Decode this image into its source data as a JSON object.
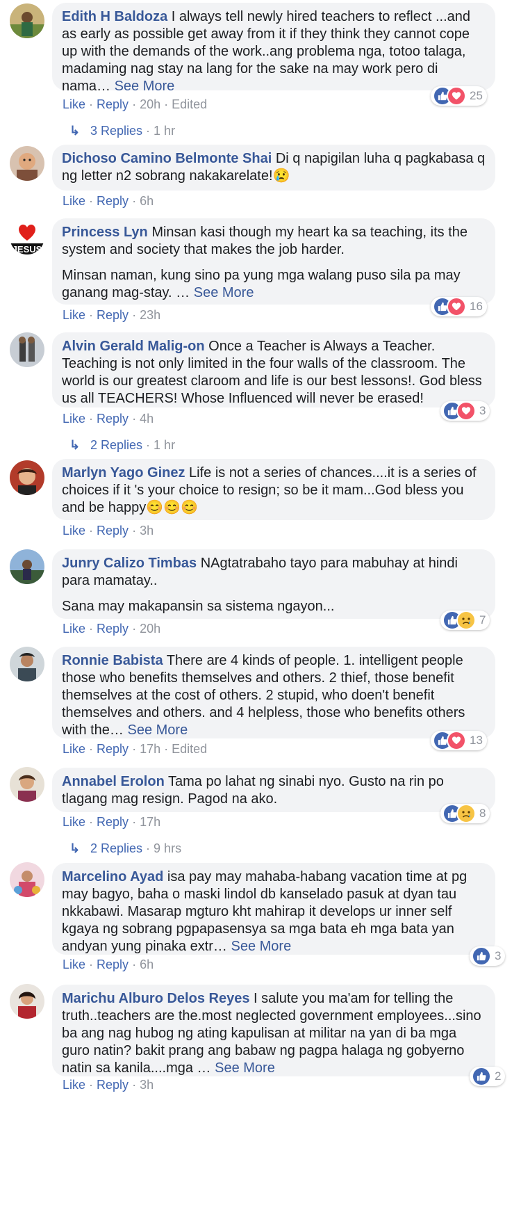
{
  "see_more": "See More",
  "like_label": "Like",
  "reply_label": "Reply",
  "comments": [
    {
      "author": "Edith H Baldoza",
      "paragraphs": [
        "I always tell newly hired teachers to reflect ...and as early as possible get away from it if they think they cannot cope up with the demands of the work..ang problema nga, totoo talaga, madaming nag stay na lang for the sake na may work pero di nama…"
      ],
      "see_more": true,
      "time": "20h",
      "edited": "Edited",
      "reactions": [
        "like",
        "love"
      ],
      "count": "25",
      "avatar_icon": "avatar-photo"
    },
    {
      "author": "Dichoso Camino Belmonte Shai",
      "paragraphs": [
        "Di q napigilan luha q pagkabasa q ng letter n2 sobrang nakakarelate!😢"
      ],
      "see_more": false,
      "time": "6h",
      "avatar_icon": "avatar-photo"
    },
    {
      "author": "Princess Lyn",
      "paragraphs": [
        "Minsan kasi though my heart ka sa teaching, its the system and society that makes the job harder.",
        "Minsan naman, kung sino pa yung mga walang puso sila pa may ganang mag-stay. …"
      ],
      "see_more": true,
      "time": "23h",
      "reactions": [
        "like",
        "love"
      ],
      "count": "16",
      "avatar_icon": "avatar-heart-jesus"
    },
    {
      "author": "Alvin Gerald Malig-on",
      "paragraphs": [
        "Once a Teacher is Always a Teacher. Teaching is not only limited in the four walls of the classroom. The world is our greatest claroom and life is our best lessons!. God bless us all TEACHERS! Whose Influenced will never be erased!"
      ],
      "see_more": false,
      "time": "4h",
      "reactions": [
        "like",
        "love"
      ],
      "count": "3",
      "avatar_icon": "avatar-photo"
    },
    {
      "author": "Marlyn Yago Ginez",
      "paragraphs": [
        "Life is not a series of chances....it is a series of choices if it 's your choice to resign; so be it mam...God bless you and be happy😊😊😊"
      ],
      "see_more": false,
      "time": "3h",
      "avatar_icon": "avatar-photo"
    },
    {
      "author": "Junry Calizo Timbas",
      "paragraphs": [
        "NAgtatrabaho tayo para mabuhay at hindi para mamatay..",
        "Sana may makapansin sa sistema ngayon..."
      ],
      "see_more": false,
      "time": "20h",
      "reactions": [
        "like",
        "sad"
      ],
      "count": "7",
      "avatar_icon": "avatar-photo"
    },
    {
      "author": "Ronnie Babista",
      "paragraphs": [
        "There are 4 kinds of people. 1. intelligent people those who benefits themselves and others. 2 thief, those benefit themselves at the cost of others. 2 stupid, who doen't benefit themselves and others. and 4 helpless, those who benefits others with the…"
      ],
      "see_more": true,
      "time": "17h",
      "edited": "Edited",
      "reactions": [
        "like",
        "love"
      ],
      "count": "13",
      "avatar_icon": "avatar-photo"
    },
    {
      "author": "Annabel Erolon",
      "paragraphs": [
        "Tama po lahat ng sinabi nyo. Gusto na rin po tlagang mag resign. Pagod na ako."
      ],
      "see_more": false,
      "time": "17h",
      "reactions": [
        "like",
        "sad"
      ],
      "count": "8",
      "avatar_icon": "avatar-photo"
    },
    {
      "author": "Marcelino Ayad",
      "paragraphs": [
        "isa pay may mahaba-habang vacation time at pg may bagyo, baha o maski lindol db kanselado pasuk at dyan tau nkkabawi. Masarap mgturo kht mahirap it develops ur inner self kgaya ng sobrang pgpapasensya sa mga bata eh mga bata yan andyan yung pinaka extr…"
      ],
      "see_more": true,
      "time": "6h",
      "reactions": [
        "like"
      ],
      "count": "3",
      "avatar_icon": "avatar-photo"
    },
    {
      "author": "Marichu Alburo Delos Reyes",
      "paragraphs": [
        "I salute you ma'am for telling the truth..teachers are the.most neglected government employees...sino ba ang nag hubog ng ating kapulisan at militar na yan di ba mga guro natin? bakit prang ang babaw ng pagpa halaga ng gobyerno natin sa kanila....mga …"
      ],
      "see_more": true,
      "time": "3h",
      "reactions": [
        "like"
      ],
      "count": "2",
      "avatar_icon": "avatar-photo"
    }
  ],
  "reply_threads": [
    {
      "label": "3 Replies",
      "time": "1 hr"
    },
    {
      "label": "2 Replies",
      "time": "1 hr"
    },
    {
      "label": "2 Replies",
      "time": "9 hrs"
    }
  ],
  "colors": {
    "link": "#385898",
    "action": "#4267b2",
    "muted": "#90949c",
    "bubble": "#f2f3f5",
    "love": "#f25268",
    "sad": "#f7c444"
  }
}
